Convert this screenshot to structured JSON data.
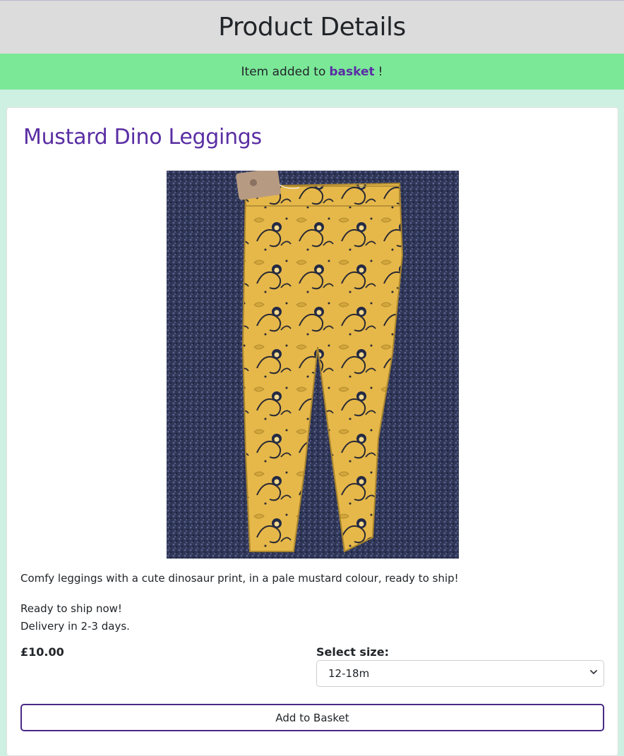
{
  "header": {
    "title": "Product Details"
  },
  "alert": {
    "prefix": "Item added to",
    "link_text": "basket",
    "suffix": "!"
  },
  "product": {
    "name": "Mustard Dino Leggings",
    "image_alt": "Mustard dinosaur print leggings on a navy carpet",
    "description": "Comfy leggings with a cute dinosaur print, in a pale mustard colour, ready to ship!",
    "shipping_line1": "Ready to ship now!",
    "shipping_line2": "Delivery in 2-3 days.",
    "price": "£10.00"
  },
  "size_selector": {
    "label": "Select size:",
    "selected": "12-18m",
    "icon": "chevron-down-icon"
  },
  "actions": {
    "add_to_basket": "Add to Basket"
  },
  "colors": {
    "header_bg": "#dcdcdc",
    "alert_bg": "#7be898",
    "page_bg": "#cdf0e2",
    "accent_purple": "#5a2ea3",
    "button_border": "#4a2a86",
    "leggings_mustard": "#e6b84a",
    "carpet_navy": "#2f3656"
  }
}
